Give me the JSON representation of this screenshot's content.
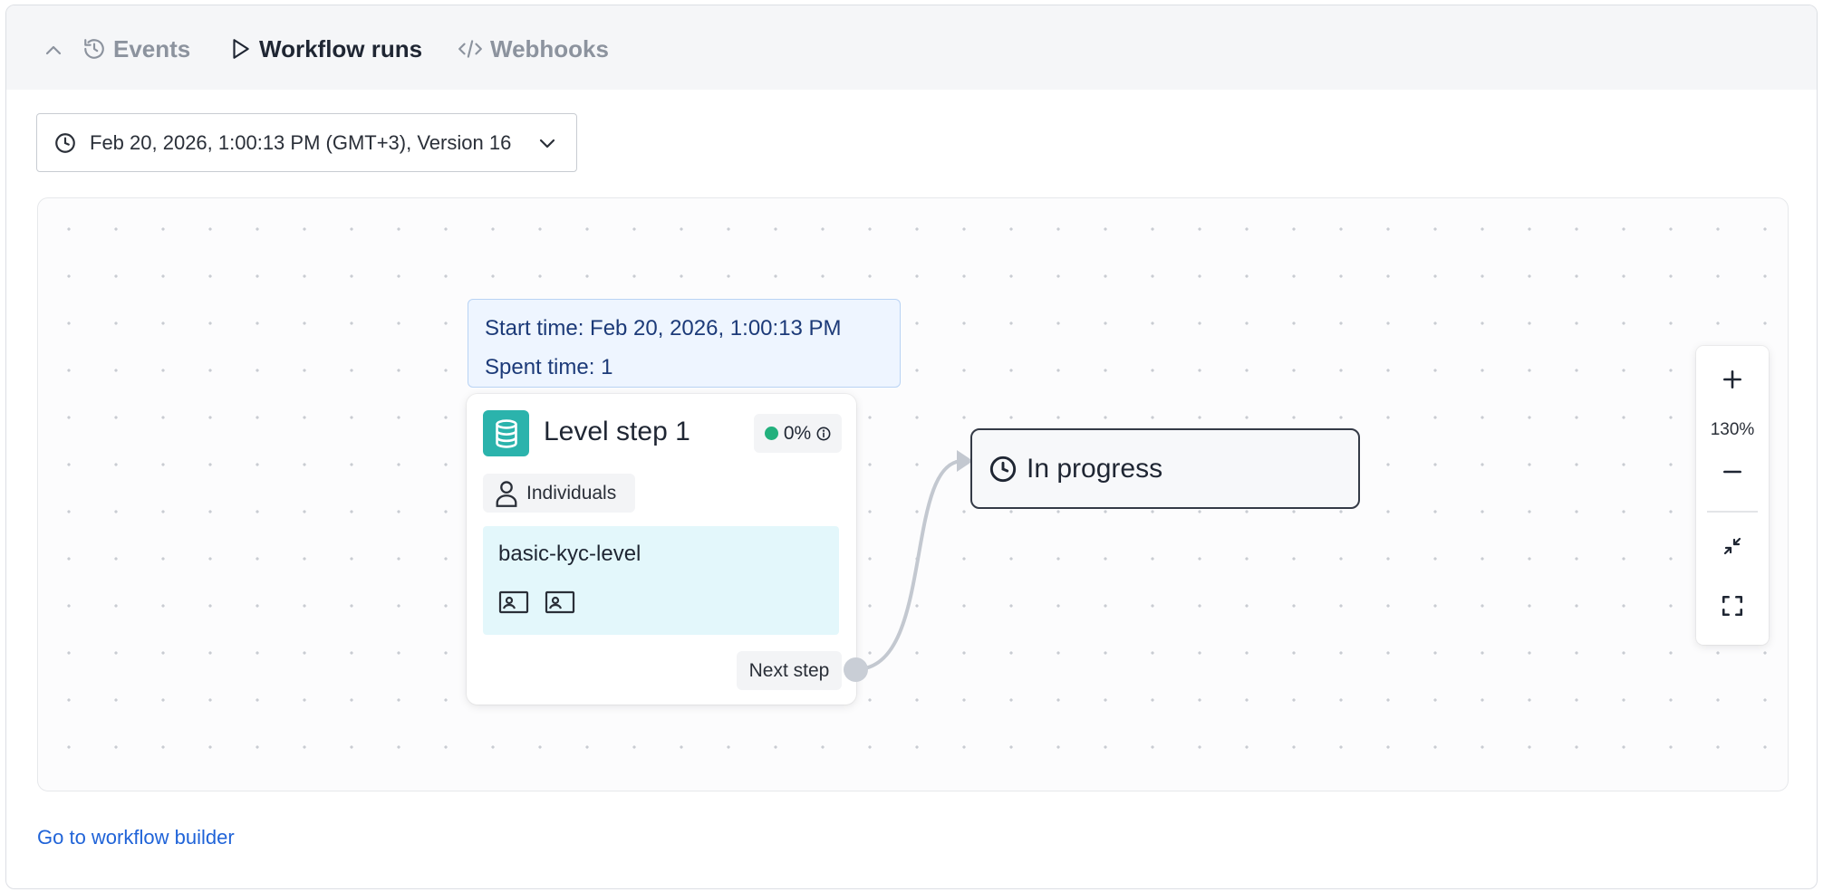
{
  "tabs": [
    {
      "label": "Events",
      "icon": "history-icon",
      "active": false
    },
    {
      "label": "Workflow runs",
      "icon": "play-icon",
      "active": true
    },
    {
      "label": "Webhooks",
      "icon": "code-icon",
      "active": false
    }
  ],
  "version_select": {
    "label": "Feb 20, 2026, 1:00:13 PM (GMT+3), Version 16",
    "icon": "clock-icon"
  },
  "tooltip": {
    "start_time": "Start time: Feb 20, 2026, 1:00:13 PM",
    "spent_time": "Spent time: 1"
  },
  "step": {
    "title": "Level step 1",
    "progress": "0%",
    "progress_color": "#22b07d",
    "audience": "Individuals",
    "level_name": "basic-kyc-level",
    "next_label": "Next step",
    "accent": "#2bb3ac"
  },
  "status_node": {
    "label": "In progress"
  },
  "zoom": {
    "level": "130%"
  },
  "footer": {
    "builder_link": "Go to workflow builder"
  }
}
